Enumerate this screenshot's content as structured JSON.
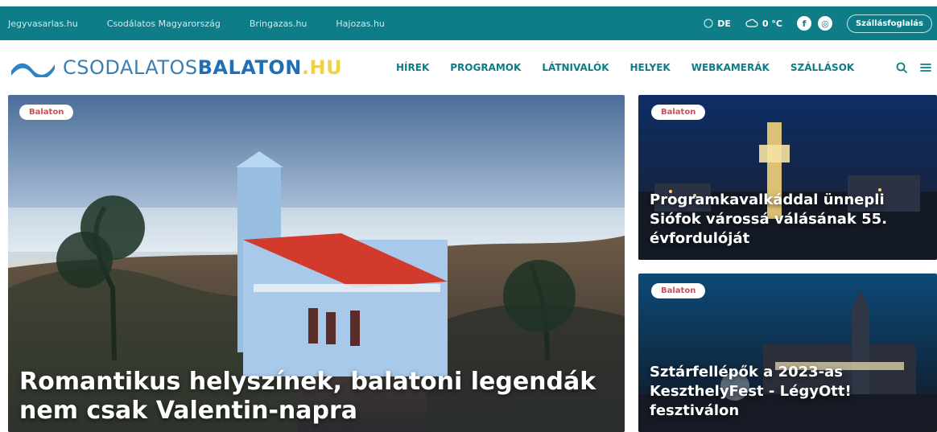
{
  "topbar": {
    "links": [
      "Jegyvasarlas.hu",
      "Csodálatos Magyarország",
      "Bringazas.hu",
      "Hajozas.hu"
    ],
    "lang": "DE",
    "weather": "0 °C",
    "book": "Szállásfoglalás",
    "social": {
      "facebook": "f",
      "instagram": "◎"
    }
  },
  "logo": {
    "part1": "CSODALATOS",
    "part2": "BALATON",
    "part3": ".HU"
  },
  "menu": {
    "items": [
      "HÍREK",
      "PROGRAMOK",
      "LÁTNIVALÓK",
      "HELYEK",
      "WEBKAMERÁK",
      "SZÁLLÁSOK"
    ]
  },
  "articles": {
    "main": {
      "badge": "Balaton",
      "title": "Romantikus helyszínek, balatoni legendák nem csak Valentin-napra"
    },
    "side1": {
      "badge": "Balaton",
      "title": "Programkavalkáddal ünnepli Siófok várossá válásának 55. évfordulóját"
    },
    "side2": {
      "badge": "Balaton",
      "title": "Sztárfellépők a 2023-as KeszthelyFest - LégyOtt! fesztiválon"
    }
  },
  "colors": {
    "topbar": "#0f7d87",
    "menu": "#0b7d86",
    "badge": "#d24b58"
  }
}
